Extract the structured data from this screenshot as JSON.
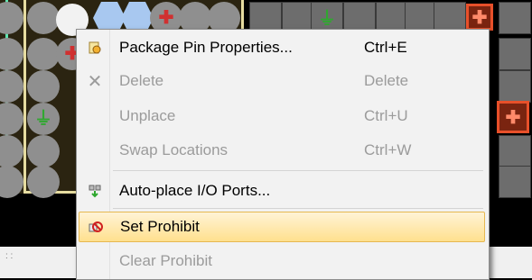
{
  "menu": {
    "items": [
      {
        "label": "Package Pin Properties...",
        "shortcut": "Ctrl+E",
        "icon": "properties-icon",
        "enabled": true
      },
      {
        "label": "Delete",
        "shortcut": "Delete",
        "icon": "delete-x-icon",
        "enabled": false
      },
      {
        "label": "Unplace",
        "shortcut": "Ctrl+U",
        "icon": "",
        "enabled": false
      },
      {
        "label": "Swap Locations",
        "shortcut": "Ctrl+W",
        "icon": "",
        "enabled": false
      },
      {
        "label": "Auto-place I/O Ports...",
        "shortcut": "",
        "icon": "auto-place-icon",
        "enabled": true
      },
      {
        "label": "Set Prohibit",
        "shortcut": "",
        "icon": "prohibit-icon",
        "enabled": true,
        "highlighted": true
      },
      {
        "label": "Clear Prohibit",
        "shortcut": "",
        "icon": "",
        "enabled": false
      }
    ]
  },
  "colors": {
    "highlight": "#ffe08e",
    "selected_pin": "#e8502a",
    "bank_border": "#e6dca0",
    "ground": "#2fa82f",
    "power": "#d03030"
  }
}
